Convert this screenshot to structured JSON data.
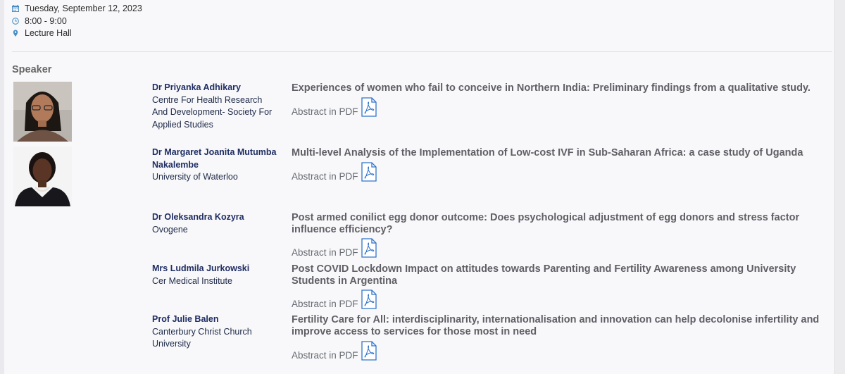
{
  "event": {
    "date": "Tuesday, September 12, 2023",
    "time": "8:00 - 9:00",
    "location": "Lecture Hall"
  },
  "section_title": "Speaker",
  "speakers": [
    {
      "name": "Dr Priyanka Adhikary",
      "affiliation_lines": [
        "Centre For Health Research",
        "And Development- Society For",
        "Applied Studies"
      ],
      "talk_title": "Experiences of women who fail to conceive in Northern India: Preliminary findings from a qualitative study.",
      "abstract_label": "Abstract in PDF"
    },
    {
      "name_lines": [
        "Dr Margaret Joanita Mutumba",
        "Nakalembe"
      ],
      "affiliation_lines": [
        "University of Waterloo"
      ],
      "talk_title": "Multi-level Analysis of the Implementation of Low-cost IVF in Sub-Saharan Africa: a case study of Uganda",
      "abstract_label": "Abstract in PDF"
    },
    {
      "name": "Dr Oleksandra Kozyra",
      "affiliation_lines": [
        "Ovogene"
      ],
      "talk_title_lines": [
        "Post armed conilict egg donor outcome: Does psychological adjustment of egg donors and stress factor",
        "influence efficiency?"
      ],
      "abstract_label": "Abstract in PDF"
    },
    {
      "name": "Mrs Ludmila Jurkowski",
      "affiliation_lines": [
        "Cer Medical Institute"
      ],
      "talk_title_lines": [
        "Post COVID Lockdown Impact on attitudes towards Parenting and Fertility Awareness among University",
        "Students in Argentina"
      ],
      "abstract_label": "Abstract in PDF"
    },
    {
      "name": "Prof Julie Balen",
      "affiliation_lines": [
        "Canterbury Christ Church",
        "University"
      ],
      "talk_title_lines": [
        "Fertility Care for All: interdisciplinarity, internationalisation and innovation can help decolonise infertility and",
        "improve access to services for those most in need"
      ],
      "abstract_label": "Abstract in PDF"
    }
  ],
  "colors": {
    "icon_blue": "#4a8fc4",
    "name_navy": "#1f2d63",
    "title_gray": "#5f5f65",
    "pdf_blue": "#2f73c9"
  },
  "icons": {
    "date": "calendar-icon",
    "time": "clock-icon",
    "location": "map-pin-icon",
    "abstract": "pdf-document-icon"
  }
}
